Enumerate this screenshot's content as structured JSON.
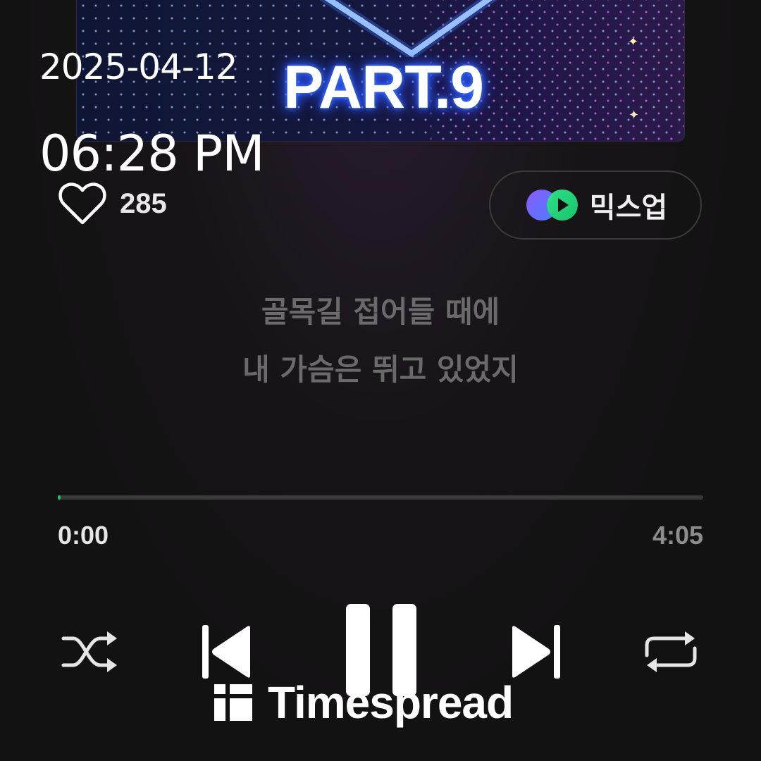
{
  "album": {
    "title_text": "PART.9"
  },
  "overlay": {
    "date": "2025-04-12",
    "time": "06:28 PM"
  },
  "like": {
    "icon": "heart-outline-icon",
    "count": "285"
  },
  "mixup": {
    "icon": "mixup-logo-icon",
    "label": "믹스업"
  },
  "lyrics": [
    "골목길 접어들 때에",
    "내 가슴은 뛰고 있었지"
  ],
  "player": {
    "elapsed": "0:00",
    "total": "4:05",
    "progress_fraction": 0.003,
    "accent_color": "#1ec05a"
  },
  "controls": {
    "shuffle": "shuffle-icon",
    "previous": "skip-previous-icon",
    "play_pause": "pause-icon",
    "next": "skip-next-icon",
    "repeat": "repeat-icon"
  },
  "watermark": {
    "text": "Timespread"
  }
}
